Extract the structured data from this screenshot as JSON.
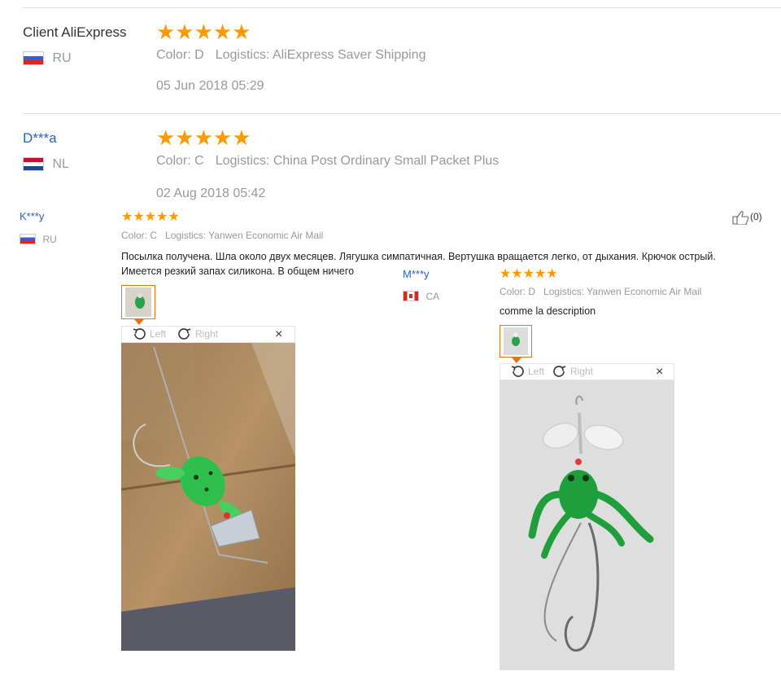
{
  "reviews_top": [
    {
      "name": "Client AliExpress",
      "country": "RU",
      "rating_stars": "★★★★★",
      "rating": 5,
      "color_label": "Color: D",
      "logistics_label": "Logistics: AliExpress Saver Shipping",
      "date": "05 Jun 2018 05:29"
    },
    {
      "name": "D***a",
      "country": "NL",
      "rating_stars": "★★★★★",
      "rating": 5,
      "color_label": "Color: C",
      "logistics_label": "Logistics: China Post Ordinary Small Packet Plus",
      "date": "02 Aug 2018 05:42"
    }
  ],
  "review_k": {
    "name": "K***y",
    "country": "RU",
    "rating_stars": "★★★★★",
    "rating": 5,
    "color_label": "Color: C",
    "logistics_label": "Logistics: Yanwen Economic Air Mail",
    "text_line1": "Посылка получена. Шла около двух месяцев. Лягушка симпатичная. Вертушка вращается легко, от дыхания. Крючок острый.",
    "text_line2": "Имеется резкий запах силикона. В общем ничего",
    "helpful_count": "(0)",
    "viewer": {
      "left": "Left",
      "right": "Right",
      "close": "×"
    }
  },
  "review_m": {
    "name": "M***y",
    "country": "CA",
    "rating_stars": "★★★★★",
    "rating": 5,
    "color_label": "Color: D",
    "logistics_label": "Logistics: Yanwen Economic Air Mail",
    "text": "comme la description",
    "viewer": {
      "left": "Left",
      "right": "Right",
      "close": "×"
    }
  },
  "colors": {
    "star": "#ff9900",
    "link": "#2a62b8",
    "thumb_border": "#e8721c"
  }
}
